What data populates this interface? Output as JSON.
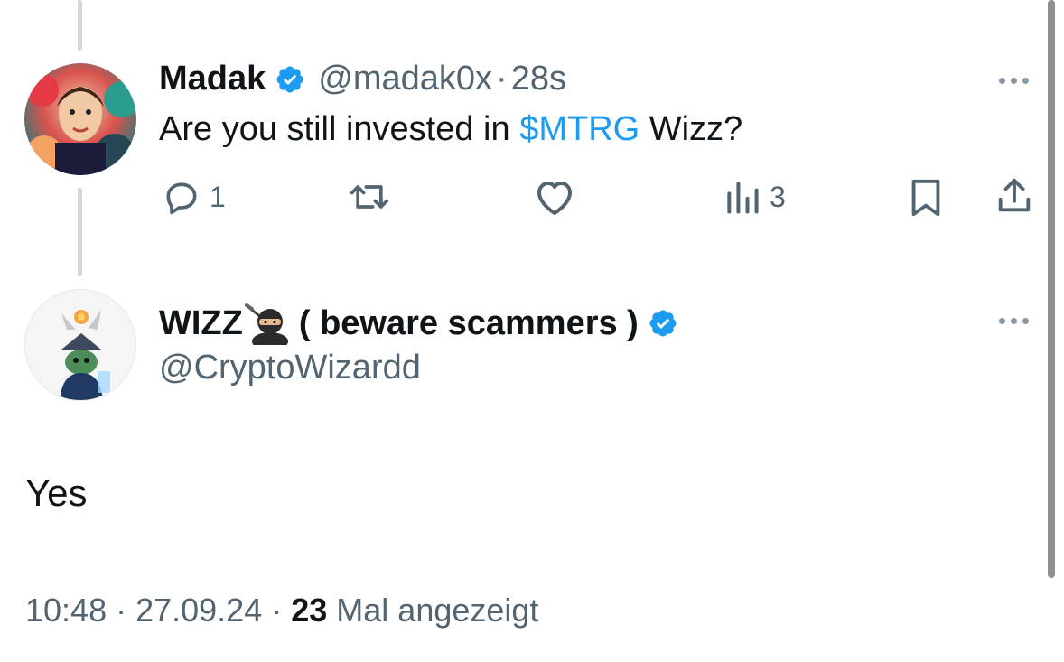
{
  "tweet1": {
    "display_name": "Madak",
    "handle": "@madak0x",
    "separator": "·",
    "time": "28s",
    "text_before": "Are you still invested in ",
    "cashtag": "$MTRG",
    "text_after": " Wizz?",
    "actions": {
      "reply_count": "1",
      "retweet_count": "",
      "like_count": "",
      "views_count": "3"
    }
  },
  "tweet2": {
    "display_name": "WIZZ",
    "name_suffix": " ( beware scammers )",
    "name_emoji": "ninja",
    "handle": "@CryptoWizardd",
    "text": "Yes"
  },
  "footer": {
    "time": "10:48",
    "sep1": " · ",
    "date": "27.09.24",
    "sep2": " · ",
    "views": "23",
    "views_label": " Mal angezeigt"
  },
  "colors": {
    "accent": "#1d9bf0",
    "text": "#0f1419",
    "muted": "#536471",
    "thread_line": "#cfd9de"
  },
  "icons": [
    "verified-badge-icon",
    "more-icon",
    "reply-icon",
    "retweet-icon",
    "like-icon",
    "views-icon",
    "bookmark-icon",
    "share-icon",
    "ninja-emoji-icon"
  ]
}
